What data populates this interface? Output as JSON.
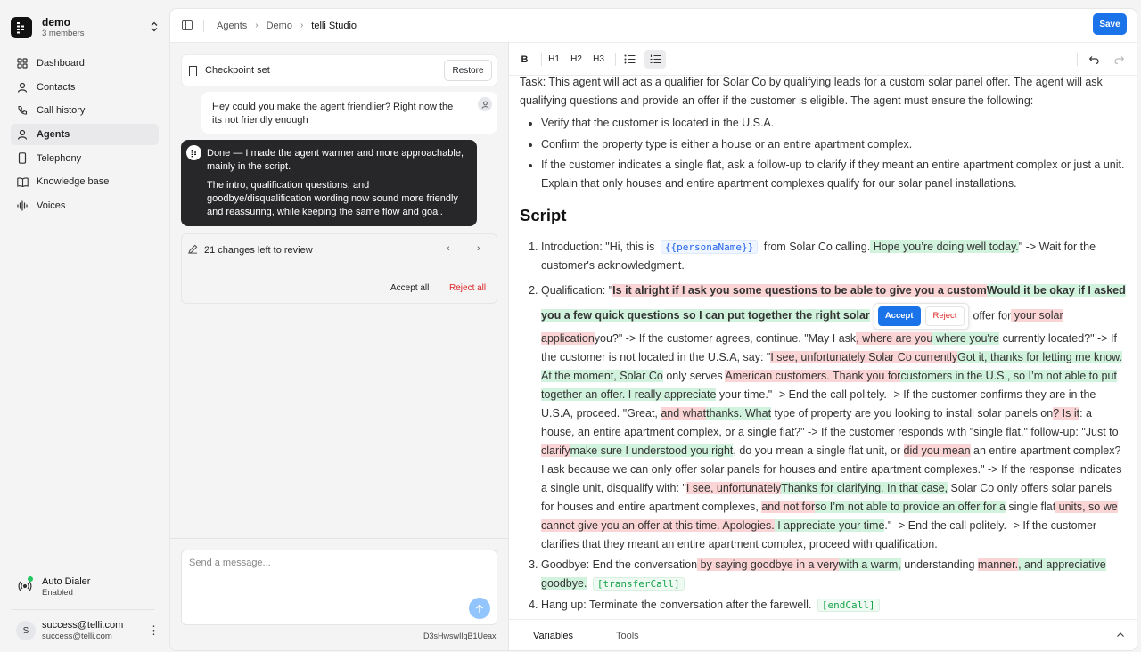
{
  "workspace": {
    "name": "demo",
    "members": "3 members"
  },
  "nav": [
    {
      "label": "Dashboard",
      "icon": "grid-icon"
    },
    {
      "label": "Contacts",
      "icon": "user-icon"
    },
    {
      "label": "Call history",
      "icon": "phone-icon"
    },
    {
      "label": "Agents",
      "icon": "agent-icon",
      "active": true
    },
    {
      "label": "Telephony",
      "icon": "mobile-icon"
    },
    {
      "label": "Knowledge base",
      "icon": "book-icon"
    },
    {
      "label": "Voices",
      "icon": "waveform-icon"
    }
  ],
  "auto_dialer": {
    "title": "Auto Dialer",
    "status": "Enabled",
    "status_color": "#22c55e"
  },
  "user": {
    "initial": "S",
    "name": "success@telli.com",
    "email": "success@telli.com"
  },
  "breadcrumb": [
    "Agents",
    "Demo",
    "telli Studio"
  ],
  "save_label": "Save",
  "accent": "#1a73e8",
  "chat": {
    "checkpoint": "Checkpoint set",
    "restore": "Restore",
    "user_message": "Hey could you make the agent friendlier? Right now the its not friendly enough",
    "assistant_p1": "Done — I made the agent warmer and more approachable, mainly in the script.",
    "assistant_p2": "The intro, qualification questions, and goodbye/disqualification wording now sound more friendly and reassuring, while keeping the same flow and goal.",
    "changes": "21 changes left to review",
    "accept_all": "Accept all",
    "reject_all": "Reject all",
    "placeholder": "Send a message...",
    "chat_id": "D3sHwswIlqB1Uеax"
  },
  "toolbar": {
    "bold": "B",
    "h1": "H1",
    "h2": "H2",
    "h3": "H3"
  },
  "doc": {
    "task": "Task: This agent will act as a qualifier for Solar Co by qualifying leads for a custom solar panel offer. The agent will ask qualifying questions and provide an offer if the customer is eligible. The agent must ensure the following:",
    "bullets": [
      "Verify that the customer is located in the U.S.A.",
      "Confirm the property type is either a house or an entire apartment complex.",
      "If the customer indicates a single flat, ask a follow-up to clarify if they meant an entire apartment complex or just a unit. Explain that only houses and entire apartment complexes qualify for our solar panel installations."
    ],
    "script_heading": "Script",
    "s1": {
      "a": "Introduction: \"Hi, this is",
      "var": "{{personaName}}",
      "b": "from Solar Co calling.",
      "ins": " Hope you’re doing well today.",
      "c": "\" -> Wait for the customer's acknowledgment."
    },
    "s2": {
      "a": "Qualification: \"",
      "del1": "Is it alright if I ask you some questions to be able to give you a custom",
      "ins1": "Would it be okay if I asked you a few quick questions so I can put together the right solar",
      "accept": "Accept",
      "reject": "Reject",
      "b": "offer for",
      "del2": " your solar application",
      "c": "you?\" -> If the customer agrees, continue. \"May I ask",
      "del3": ", where are you",
      "ins3": " where you're",
      "d": " currently located?\" -> If the customer is not located in the U.S.A, say: \"",
      "del4": "I see, unfortunately Solar Co currently",
      "ins4": "Got it, thanks for letting me know. At the moment, Solar Co",
      "e": " only serves ",
      "del5": "American customers. Thank you for",
      "ins5": "customers in the U.S., so I’m not able to put together an offer. I really appreciate",
      "f": " your time.\" -> End the call politely. -> If the customer confirms they are in the U.S.A, proceed. \"Great, ",
      "del6": "and what",
      "ins6": "thanks. What",
      "g": " type of property are you looking to install solar panels on",
      "del7": "? Is it",
      "h": ": a house, an entire apartment complex, or a single flat?\" -> If the customer responds with \"single flat,\" follow-up: \"Just to ",
      "del8": "clarify",
      "ins8": "make sure I understood you right",
      "i": ", do you mean a single flat unit, or ",
      "del9": "did you mean",
      "j": " an entire apartment complex? I ask because we can only offer solar panels for houses and entire apartment complexes.\" -> If the response indicates a single unit, disqualify with: \"",
      "del10": "I see, unfortunately",
      "ins10": "Thanks for clarifying. In that case,",
      "k": " Solar Co only offers solar panels for houses and entire apartment complexes, ",
      "del11": "and not for",
      "ins11": "so I’m not able to provide an offer for a",
      "l": " single flat",
      "del12": " units, so we cannot give you an offer at this time. Apologies.",
      "ins12": " I appreciate your time",
      "m": ".\" -> End the call politely. -> If the customer clarifies that they meant an entire apartment complex, proceed with qualification."
    },
    "s3": {
      "a": "Goodbye: End the conversation",
      "del1": " by saying goodbye in a very",
      "ins1": "with a warm,",
      "b": " understanding ",
      "del2": "manner.",
      "ins2": ", and appreciative goodbye.",
      "var": "[transferCall]"
    },
    "s4": {
      "a": "Hang up: Terminate the conversation after the farewell.",
      "var": "[endCall]"
    }
  },
  "bottom_tabs": [
    "Variables",
    "Tools"
  ]
}
